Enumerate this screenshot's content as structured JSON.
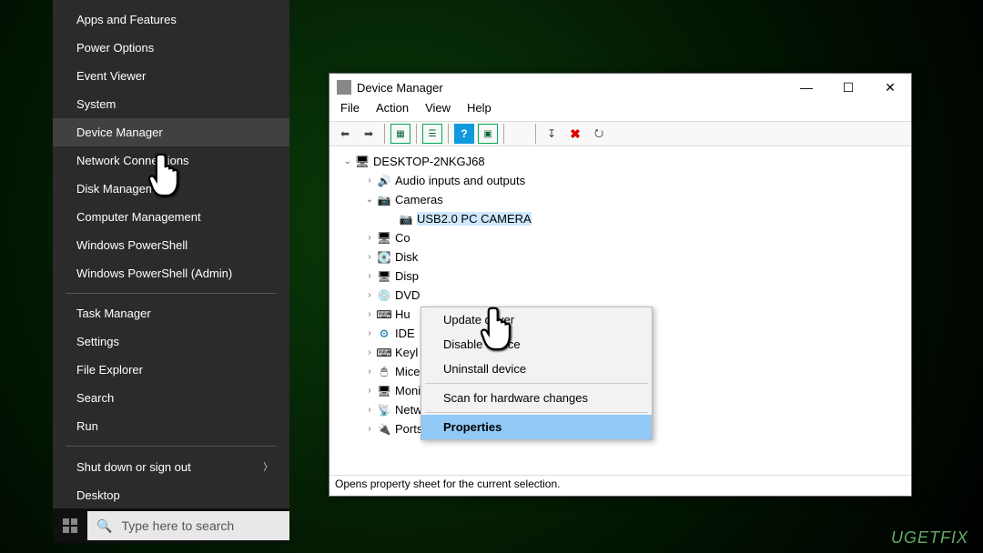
{
  "winx": {
    "items": [
      {
        "label": "Apps and Features"
      },
      {
        "label": "Power Options"
      },
      {
        "label": "Event Viewer"
      },
      {
        "label": "System"
      },
      {
        "label": "Device Manager",
        "highlight": true
      },
      {
        "label": "Network Connections"
      },
      {
        "label": "Disk Management"
      },
      {
        "label": "Computer Management"
      },
      {
        "label": "Windows PowerShell"
      },
      {
        "label": "Windows PowerShell (Admin)"
      }
    ],
    "group2": [
      {
        "label": "Task Manager"
      },
      {
        "label": "Settings"
      },
      {
        "label": "File Explorer"
      },
      {
        "label": "Search"
      },
      {
        "label": "Run"
      }
    ],
    "group3": [
      {
        "label": "Shut down or sign out",
        "submenu": true
      },
      {
        "label": "Desktop"
      }
    ]
  },
  "taskbar": {
    "search_placeholder": "Type here to search"
  },
  "devmgr": {
    "title": "Device Manager",
    "menu": [
      "File",
      "Action",
      "View",
      "Help"
    ],
    "root": "DESKTOP-2NKGJ68",
    "nodes": [
      {
        "label": "Audio inputs and outputs",
        "icon": "audio"
      },
      {
        "label": "Cameras",
        "icon": "cam",
        "expanded": true,
        "children": [
          {
            "label": "USB2.0 PC CAMERA",
            "icon": "cam",
            "selected": true
          }
        ]
      },
      {
        "label": "Computer",
        "icon": "pc",
        "partial": "Co"
      },
      {
        "label": "Disk drives",
        "icon": "disk",
        "partial": "Disk"
      },
      {
        "label": "Display adapters",
        "icon": "disp",
        "partial": "Disp"
      },
      {
        "label": "DVD/CD-ROM drives",
        "icon": "dvd",
        "partial": "DVD"
      },
      {
        "label": "Human Interface Devices",
        "icon": "hid",
        "partial": "Hu"
      },
      {
        "label": "IDE ATA/ATAPI controllers",
        "icon": "ide",
        "partial": "IDE "
      },
      {
        "label": "Keyboards",
        "icon": "kb",
        "partial": "Keyl"
      },
      {
        "label": "Mice and other pointing devices",
        "icon": "mouse"
      },
      {
        "label": "Monitors",
        "icon": "mon"
      },
      {
        "label": "Network adapters",
        "icon": "net"
      },
      {
        "label": "Ports (COM & LPT)",
        "icon": "port"
      }
    ],
    "status": "Opens property sheet for the current selection.",
    "context_menu": [
      {
        "label": "Update driver"
      },
      {
        "label": "Disable device"
      },
      {
        "label": "Uninstall device"
      },
      {
        "sep": true
      },
      {
        "label": "Scan for hardware changes"
      },
      {
        "sep": true
      },
      {
        "label": "Properties",
        "highlight": true
      }
    ]
  },
  "watermark": "UGETFIX"
}
